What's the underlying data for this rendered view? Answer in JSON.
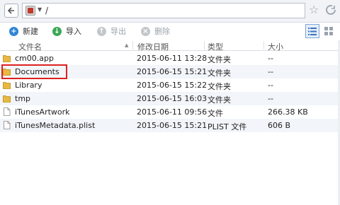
{
  "address": {
    "path": "/"
  },
  "toolbar": {
    "new_label": "新建",
    "import_label": "导入",
    "export_label": "导出",
    "delete_label": "删除"
  },
  "columns": {
    "name": "文件名",
    "modified": "修改日期",
    "type": "类型",
    "size": "大小"
  },
  "files": [
    {
      "name": "cm00.app",
      "modified": "2015-06-11 13:28",
      "type": "文件夹",
      "size": "--",
      "icon": "folder-icon"
    },
    {
      "name": "Documents",
      "modified": "2015-06-15 15:21",
      "type": "文件夹",
      "size": "--",
      "icon": "folder-icon"
    },
    {
      "name": "Library",
      "modified": "2015-06-15 15:22",
      "type": "文件夹",
      "size": "--",
      "icon": "folder-icon"
    },
    {
      "name": "tmp",
      "modified": "2015-06-15 16:03",
      "type": "文件夹",
      "size": "--",
      "icon": "folder-icon"
    },
    {
      "name": "iTunesArtwork",
      "modified": "2015-06-11 09:56",
      "type": "文件",
      "size": "266.38 KB",
      "icon": "file-icon"
    },
    {
      "name": "iTunesMetadata.plist",
      "modified": "2015-06-15 15:21",
      "type": "PLIST 文件",
      "size": "606 B",
      "icon": "file-icon"
    }
  ],
  "colors": {
    "highlight": "#e02020",
    "folder": "#e8b840",
    "accent_blue": "#2f86d6",
    "accent_green": "#3aa856"
  }
}
